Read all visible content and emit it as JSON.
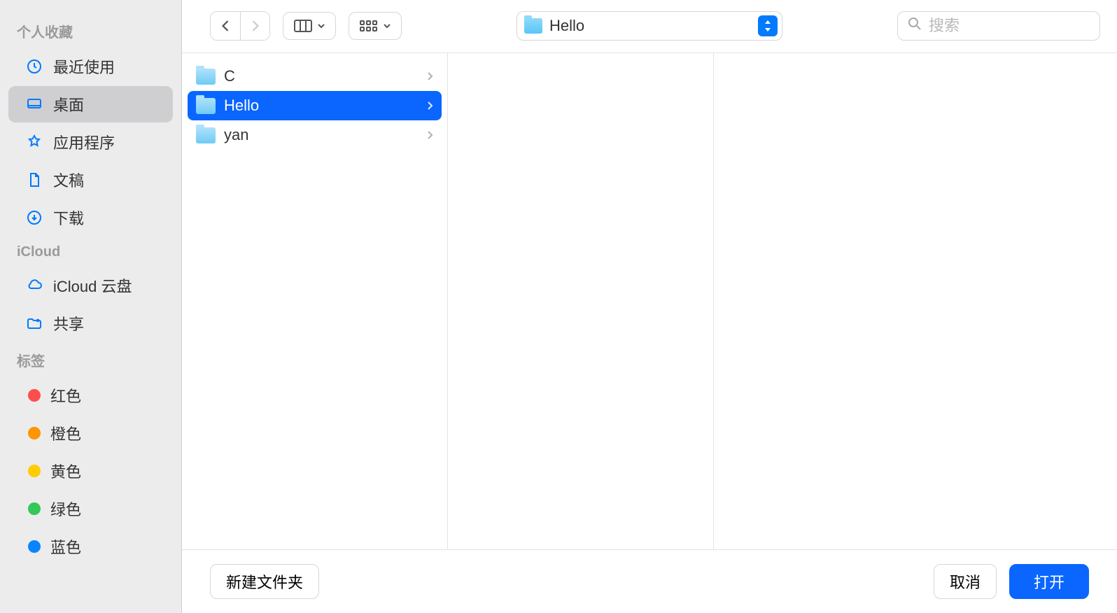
{
  "sidebar": {
    "sections": [
      {
        "title": "个人收藏",
        "items": [
          {
            "icon": "clock",
            "label": "最近使用",
            "active": false
          },
          {
            "icon": "desktop",
            "label": "桌面",
            "active": true
          },
          {
            "icon": "apps",
            "label": "应用程序",
            "active": false
          },
          {
            "icon": "document",
            "label": "文稿",
            "active": false
          },
          {
            "icon": "download",
            "label": "下载",
            "active": false
          }
        ]
      },
      {
        "title": "iCloud",
        "items": [
          {
            "icon": "cloud",
            "label": "iCloud 云盘",
            "active": false
          },
          {
            "icon": "shared-folder",
            "label": "共享",
            "active": false
          }
        ]
      },
      {
        "title": "标签",
        "items": [
          {
            "color": "#ff4d4d",
            "label": "红色"
          },
          {
            "color": "#ff9500",
            "label": "橙色"
          },
          {
            "color": "#ffcc00",
            "label": "黄色"
          },
          {
            "color": "#34c759",
            "label": "绿色"
          },
          {
            "color": "#0a84ff",
            "label": "蓝色"
          }
        ]
      }
    ]
  },
  "toolbar": {
    "path_title": "Hello",
    "search_placeholder": "搜索"
  },
  "columns": [
    {
      "items": [
        {
          "name": "C",
          "selected": false
        },
        {
          "name": "Hello",
          "selected": true
        },
        {
          "name": "yan",
          "selected": false
        }
      ]
    },
    {
      "items": []
    },
    {
      "items": []
    }
  ],
  "footer": {
    "new_folder": "新建文件夹",
    "cancel": "取消",
    "open": "打开"
  }
}
